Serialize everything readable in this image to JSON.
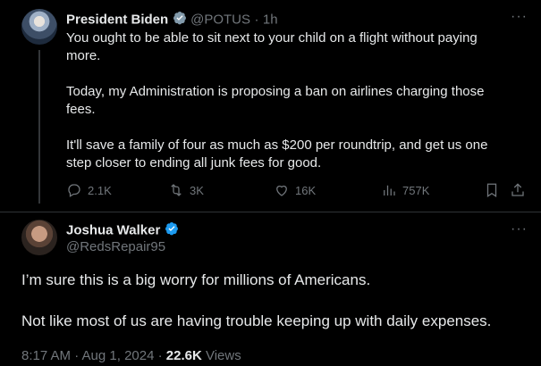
{
  "tweet": {
    "author_name": "President Biden",
    "handle": "@POTUS",
    "time": "1h",
    "paragraphs": [
      "You ought to be able to sit next to your child on a flight without paying more.",
      "Today, my Administration is proposing a ban on airlines charging those fees.",
      "It'll save a family of four as much as $200 per roundtrip, and get us one step closer to ending all junk fees for good."
    ],
    "actions": {
      "replies": "2.1K",
      "reposts": "3K",
      "likes": "16K",
      "views": "757K"
    }
  },
  "reply": {
    "author_name": "Joshua Walker",
    "handle": "@RedsRepair95",
    "paragraphs": [
      "I’m sure this is a big worry for millions of Americans.",
      "Not like most of us are having trouble keeping up with daily expenses."
    ],
    "timestamp": "8:17 AM · Aug 1, 2024 · ",
    "views_count": "22.6K",
    "views_label": "Views"
  },
  "more_label": "···",
  "colors": {
    "background": "#000000",
    "text": "#e7e9ea",
    "muted": "#71767b",
    "verified_blue": "#1d9bf0",
    "verified_gray": "#829aab"
  },
  "icons": {
    "reply": "speech-bubble-icon",
    "repost": "repost-arrows-icon",
    "like": "heart-icon",
    "views": "bar-chart-icon",
    "bookmark": "bookmark-icon",
    "share": "share-upload-icon"
  }
}
